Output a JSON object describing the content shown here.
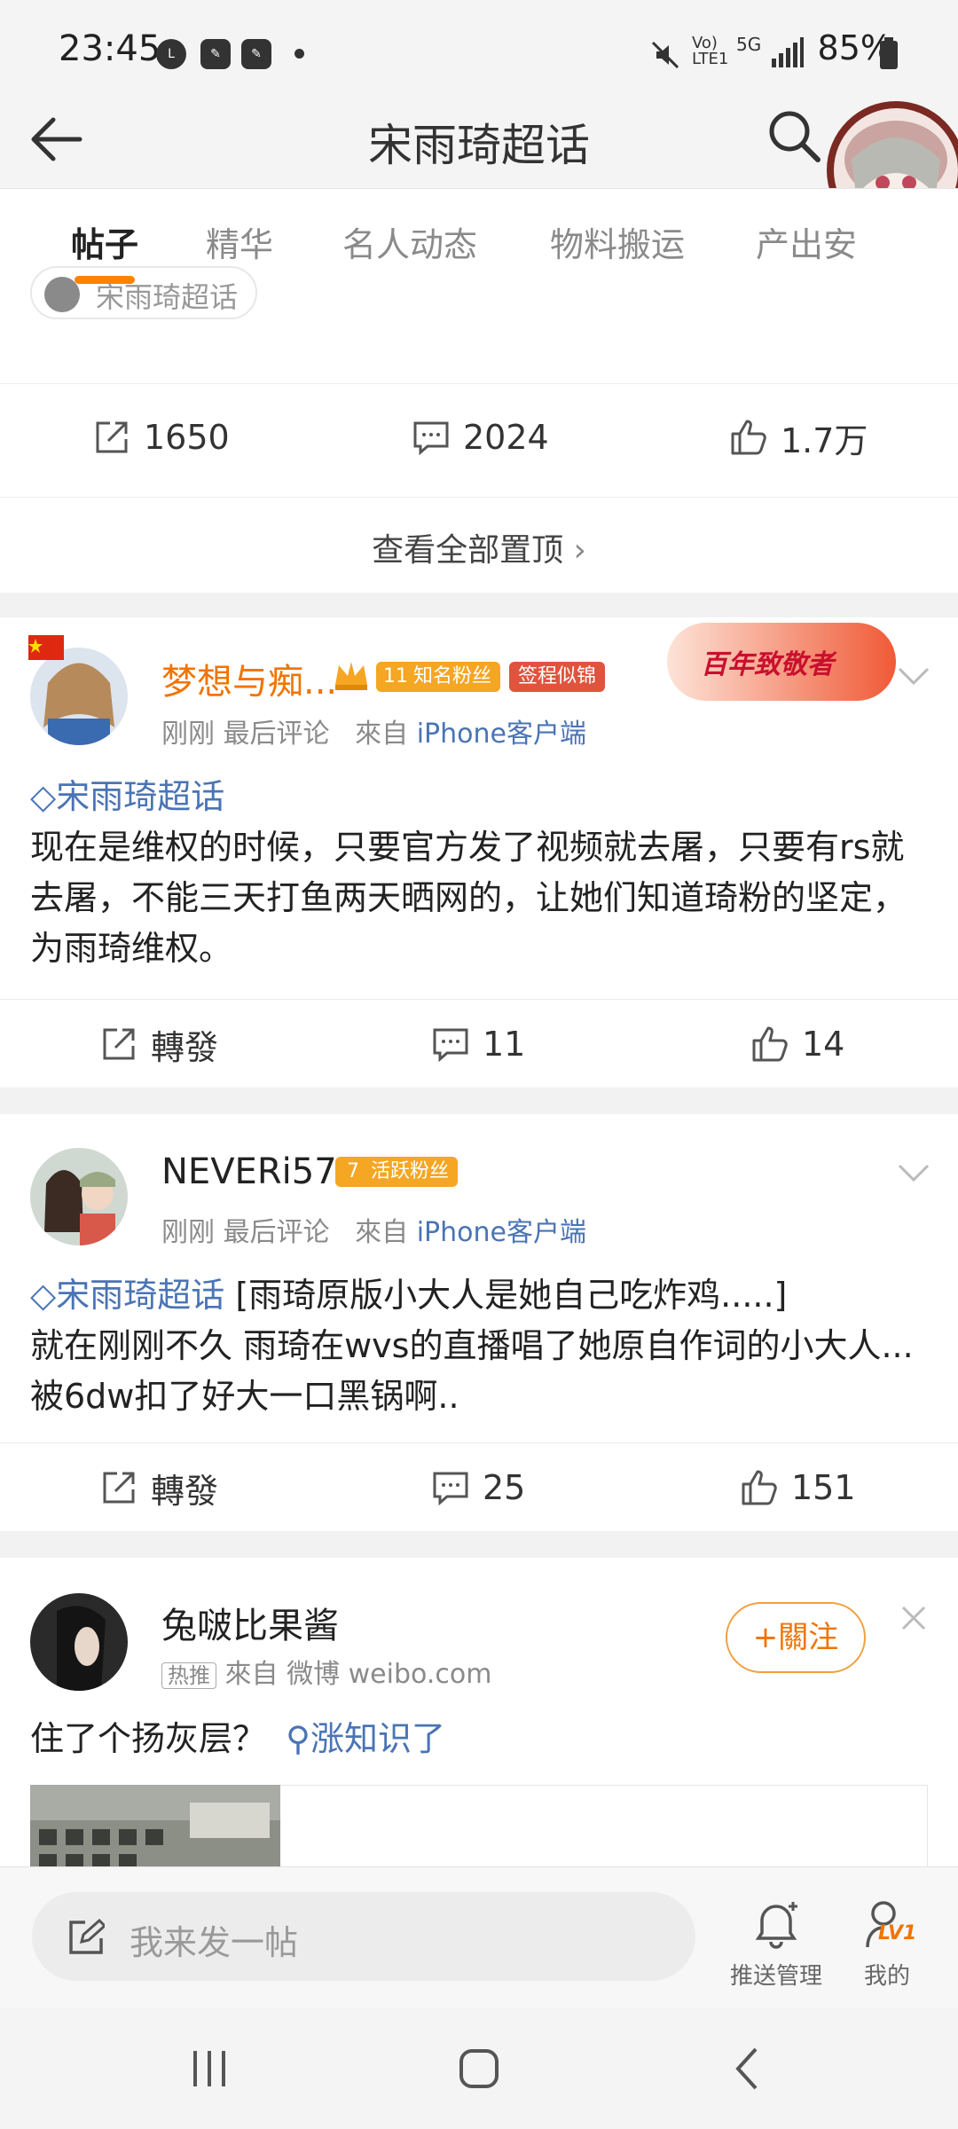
{
  "status_bar": {
    "time": "23:45",
    "icons": [
      "line-icon",
      "notification-icon",
      "notification-icon"
    ],
    "network": "5G",
    "lte": "LTE1",
    "battery": "85%"
  },
  "header": {
    "title": "宋雨琦超话"
  },
  "tabs": [
    {
      "label": "帖子",
      "active": true
    },
    {
      "label": "精华"
    },
    {
      "label": "名人动态"
    },
    {
      "label": "物料搬运"
    },
    {
      "label": "产出安"
    }
  ],
  "pinned": {
    "chip_label": "宋雨琦超话",
    "share_count": "1650",
    "comment_count": "2024",
    "like_count": "1.7万",
    "see_all": "查看全部置顶"
  },
  "posts": [
    {
      "username": "梦想与痴...",
      "badge1": "知名粉丝",
      "badge1_level": "11",
      "badge2": "签程似锦",
      "banner": "百年致敬者",
      "time": "刚刚 最后评论",
      "from_prefix": "來自",
      "source": "iPhone客户端",
      "topic": "宋雨琦超话",
      "text": "现在是维权的时候，只要官方发了视频就去屠，只要有rs就去屠，不能三天打鱼两天晒网的，让她们知道琦粉的坚定，为雨琦维权。",
      "repost": "轉發",
      "comments": "11",
      "likes": "14"
    },
    {
      "username": "NEVERi57",
      "badge1": "活跃粉丝",
      "badge1_level": "7",
      "time": "刚刚 最后评论",
      "from_prefix": "來自",
      "source": "iPhone客户端",
      "topic": "宋雨琦超话",
      "text_head": " [雨琦原版小大人是她自己吃炸鸡.....]",
      "text": "就在刚刚不久 雨琦在wvs的直播唱了她原自作词的小大人...被6dw扣了好大一口黑锅啊..",
      "repost": "轉發",
      "comments": "25",
      "likes": "151"
    },
    {
      "username": "兔啵比果酱",
      "tag": "热推",
      "from_prefix": "來自",
      "source": "微博 weibo.com",
      "follow": "+關注",
      "text": "住了个扬灰层？",
      "link": "涨知识了"
    }
  ],
  "bottom_bar": {
    "composer_placeholder": "我来发一帖",
    "push_label": "推送管理",
    "mine_label": "我的",
    "level": "LV1"
  },
  "colors": {
    "accent": "#ff8200",
    "link": "#4a74b4"
  }
}
